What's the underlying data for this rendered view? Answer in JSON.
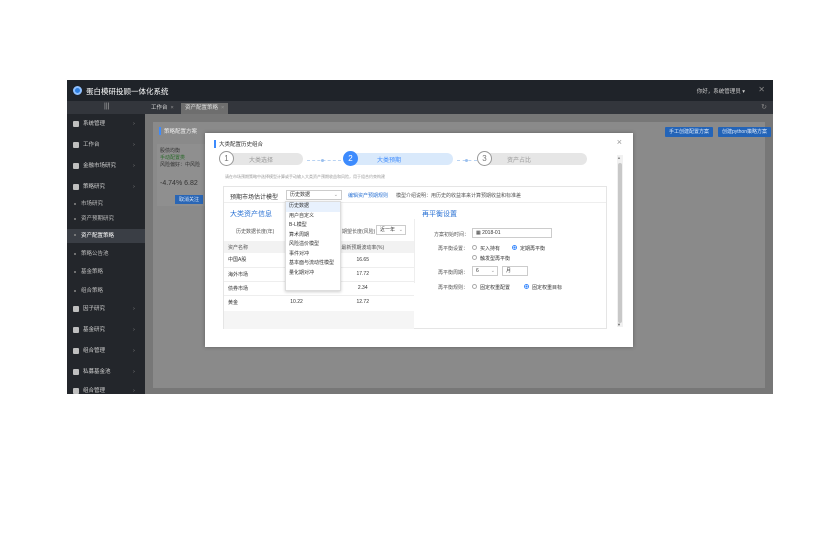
{
  "app": {
    "title": "蛋白模研投顾一体化系统",
    "user": "你好，系统管理员 ▾",
    "close": "✕"
  },
  "tabs": [
    {
      "label": "工作台",
      "close": "×"
    },
    {
      "label": "资产配置策略",
      "close": "×"
    }
  ],
  "sidebar": {
    "items": [
      {
        "label": "系统管理",
        "arrow": "›"
      },
      {
        "label": "工作台",
        "arrow": "›"
      },
      {
        "label": "金融市场研究",
        "arrow": "›"
      },
      {
        "label": "策略研究",
        "arrow": "›"
      }
    ],
    "subitems": [
      {
        "label": "市场研究"
      },
      {
        "label": "资产预期研究"
      },
      {
        "label": "资产配置策略"
      },
      {
        "label": "策略公告池"
      },
      {
        "label": "基金策略"
      },
      {
        "label": "组合策略"
      }
    ],
    "items2": [
      {
        "label": "因子研究",
        "arrow": "›"
      },
      {
        "label": "基金研究",
        "arrow": "›"
      },
      {
        "label": "组合管理",
        "arrow": "›"
      },
      {
        "label": "私募基金池",
        "arrow": "›"
      },
      {
        "label": "组合管理",
        "arrow": "›"
      }
    ]
  },
  "background": {
    "title": "策略配置方案",
    "buttons": [
      "手工创建配置方案",
      "创建python策略方案"
    ],
    "mini": {
      "line1": "股债均衡",
      "line2": "手动配置类",
      "line3": "风险偏好：中风险",
      "ret_label": "年化收益率",
      "ret_value": "-4.74%",
      "ret_value2": "6.82",
      "btn": "取消关注"
    }
  },
  "modal": {
    "title": "大类配置历史组合",
    "close": "×",
    "steps": [
      {
        "num": "1",
        "label": "大类选择"
      },
      {
        "num": "2",
        "label": "大类预期"
      },
      {
        "num": "3",
        "label": "资产占比"
      }
    ],
    "note": "请在市场预期策略中选择模型计算或手动输入大类资产预期收益和风险，用于组合约束构建",
    "estimate_label": "预期市场估计模型",
    "estimate_value": "历史数据",
    "edit_link": "编辑资产预期规则",
    "model_desc": "模型介绍说明：用历史的收益率来计算预期收益和标准差",
    "dropdown": [
      "历史数据",
      "用户自定义",
      "B-L模型",
      "算术周期",
      "风险溢价模型",
      "事件对冲",
      "基本面与流动性模型",
      "量化期对冲"
    ],
    "left": {
      "title": "大类资产信息",
      "hist_label": "历史数据长度(年)",
      "risk_label": "期望长度(风险)",
      "risk_value": "近一年",
      "columns": [
        "资产名称",
        "",
        "最新预期波动率(%)"
      ],
      "rows": [
        [
          "中国A股",
          "",
          "16.65"
        ],
        [
          "海外市场",
          "",
          "17.72"
        ],
        [
          "债券市场",
          "",
          "2.34"
        ],
        [
          "黄金",
          "10.22",
          "12.72"
        ]
      ]
    },
    "right": {
      "title": "再平衡设置",
      "start_label": "方案初始时间：",
      "start_value": "2018-01",
      "rebal_label": "再平衡设置：",
      "opt1": "买入持有",
      "opt2": "定期再平衡",
      "opt3": "触发型再平衡",
      "period_label": "再平衡周期：",
      "period_value": "6",
      "period_unit": "月",
      "rule_label": "再平衡规则：",
      "rule1": "固定权重配置",
      "rule2": "固定权重目标"
    }
  }
}
